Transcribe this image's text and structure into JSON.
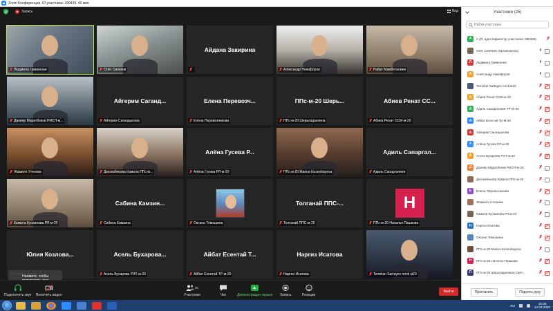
{
  "window": {
    "title": "Zoom Конференция. ID участника: 290439, 40 мин"
  },
  "topbar": {
    "record_label": "Запись",
    "view_label": "Вид"
  },
  "tiles": [
    {
      "type": "video",
      "label": "Людмила Гривенная",
      "active": true,
      "style": "v1"
    },
    {
      "type": "video",
      "label": "Олег Синяков",
      "active": false,
      "style": "v2"
    },
    {
      "type": "name",
      "center": "Айдана Закирина",
      "label": ""
    },
    {
      "type": "video",
      "label": "Александр Никифоров",
      "active": false,
      "style": "v5"
    },
    {
      "type": "video",
      "label": "Райат Мамбеталиев",
      "active": false,
      "style": "v3"
    },
    {
      "type": "video",
      "label": "Данияр Маратбеков РИСП-м...",
      "active": false,
      "style": "v4"
    },
    {
      "type": "name",
      "center": "Айгерим Саганд...",
      "label": "Айгерим Сагандыкова"
    },
    {
      "type": "name",
      "center": "Елена Перевозч...",
      "label": "Елена Перевозчикова"
    },
    {
      "type": "name",
      "center": "ППс-м-20 Шерь...",
      "label": "ППс-м-20 Шерьяздановна"
    },
    {
      "type": "name",
      "center": "Абиев Ренат СС...",
      "label": "Абиев Ренат ССМ-м-20"
    },
    {
      "type": "video",
      "label": "Жамиля Утенова",
      "active": false,
      "style": "v6"
    },
    {
      "type": "video",
      "label": "Дюсембекова Камила ППс-м...",
      "active": false,
      "style": "v7"
    },
    {
      "type": "name",
      "center": "Алёна Гусева Р...",
      "label": "Алёна Гусева РЛ-м-20"
    },
    {
      "type": "video",
      "label": "ППс-м-20 Marina Kuzenbayeva",
      "active": false,
      "style": "v8"
    },
    {
      "type": "name",
      "center": "Адиль Сапаргал...",
      "label": "Адиль Сапаргалиев"
    },
    {
      "type": "video",
      "label": "Камила Кусаинова РЛ-м-20",
      "active": false,
      "style": "v3"
    },
    {
      "type": "name",
      "center": "Сабина Камзин...",
      "label": "Сабина Камзина"
    },
    {
      "type": "portrait",
      "label": "Оксана Темошина"
    },
    {
      "type": "name",
      "center": "Толганай ППС-...",
      "label": "Толганай ППС-м-20"
    },
    {
      "type": "letter",
      "letter": "Н",
      "label": "ППс-м-20 Наталья Пашкова"
    },
    {
      "type": "name",
      "center": "Юлия Козлова...",
      "label": "Юлия Козлова"
    },
    {
      "type": "name",
      "center": "Асель Бухарова...",
      "label": "Асель Бухарова РЭТ-м-20"
    },
    {
      "type": "name",
      "center": "Айбат Есентай Т...",
      "label": "Айбат Есентай ТР-м-20"
    },
    {
      "type": "name",
      "center": "Наргиз Исатова",
      "label": "Наргиз Исатова"
    },
    {
      "type": "video",
      "label": "Temirlan Sartayev mmk м20",
      "active": false,
      "style": "v9"
    }
  ],
  "tooltip": {
    "line1": "Нажмите, чтобы",
    "line2": "подключить звук"
  },
  "toolbar": {
    "audio_label": "Подключить звук",
    "video_label": "Включить видео",
    "participants_label": "Участники",
    "participants_count": "25",
    "chat_label": "Чат",
    "share_label": "Демонстрация экрана",
    "record_label": "Запись",
    "reactions_label": "Реакции",
    "leave_label": "Выйти"
  },
  "panel": {
    "title": "Участники (25)",
    "search_placeholder": "Найти участника",
    "invite_label": "Пригласить",
    "raise_hand_label": "Поднять руку",
    "participants": [
      {
        "initial": "А",
        "color": "#2eae5b",
        "name": "А (Я, идентификатор участника: 290439)",
        "mic": "muted",
        "cam": "none"
      },
      {
        "initial": "",
        "color": "#7a6a5a",
        "name": "Олег Синяков (Организатор)",
        "mic": "on",
        "cam": "on"
      },
      {
        "initial": "Л",
        "color": "#d33a3a",
        "name": "Людмила Гривенная",
        "mic": "on",
        "cam": "on"
      },
      {
        "initial": "А",
        "color": "#f0a32d",
        "name": "Александр Никифоров",
        "mic": "on",
        "cam": "on"
      },
      {
        "initial": "",
        "color": "#4b5a70",
        "name": "Temirlan Sartayev mmk м20",
        "mic": "muted",
        "cam": "muted"
      },
      {
        "initial": "А",
        "color": "#f0a32d",
        "name": "Абиев Ренат ССМ-м-20",
        "mic": "muted",
        "cam": "muted"
      },
      {
        "initial": "А",
        "color": "#2eae5b",
        "name": "Адиль Сапаргалиев ТР-М-20",
        "mic": "muted",
        "cam": "muted"
      },
      {
        "initial": "А",
        "color": "#2d8cff",
        "name": "Айбат Есентай Тр-М-20",
        "mic": "muted",
        "cam": "muted"
      },
      {
        "initial": "А",
        "color": "#d33a3a",
        "name": "Айгерим Сагандыкова",
        "mic": "muted",
        "cam": "muted"
      },
      {
        "initial": "А",
        "color": "#2d8cff",
        "name": "Алёна Гусева РЛ-м-20",
        "mic": "muted",
        "cam": "muted"
      },
      {
        "initial": "А",
        "color": "#f0a32d",
        "name": "Асель Бухарова РЭТ-м-20",
        "mic": "muted",
        "cam": "muted"
      },
      {
        "initial": "Д",
        "color": "#f07a2d",
        "name": "Данияр Маратбеков РИСП-м-20",
        "mic": "muted",
        "cam": "on"
      },
      {
        "initial": "",
        "color": "#8d6a58",
        "name": "Дюсембекова Камила ППс-м-20",
        "mic": "muted",
        "cam": "on"
      },
      {
        "initial": "Е",
        "color": "#8a4fc9",
        "name": "Елена Перевозчикова",
        "mic": "muted",
        "cam": "muted"
      },
      {
        "initial": "",
        "color": "#9a7258",
        "name": "Жамиля Утепаева",
        "mic": "muted",
        "cam": "on"
      },
      {
        "initial": "",
        "color": "#7a6450",
        "name": "Камила Кусаинова РЛ-м-20",
        "mic": "muted",
        "cam": "on"
      },
      {
        "initial": "Н",
        "color": "#2d6ec9",
        "name": "Наргиз Исатова",
        "mic": "muted",
        "cam": "muted"
      },
      {
        "initial": "",
        "color": "#5b86b8",
        "name": "Оксана Темошина",
        "mic": "muted",
        "cam": "muted"
      },
      {
        "initial": "",
        "color": "#6b5040",
        "name": "ППс-м-20 Marina Kuzenbayeva",
        "mic": "muted",
        "cam": "on"
      },
      {
        "initial": "Н",
        "color": "#d6214e",
        "name": "ППс-м-20 Наталья Пашкова",
        "mic": "muted",
        "cam": "muted"
      },
      {
        "initial": "П",
        "color": "#3a3a6e",
        "name": "ППс-м-20 Шерьяздановна Свет...",
        "mic": "muted",
        "cam": "muted"
      }
    ]
  },
  "taskbar": {
    "lang": "RU",
    "time": "15:36",
    "date": "14.03.2020"
  }
}
